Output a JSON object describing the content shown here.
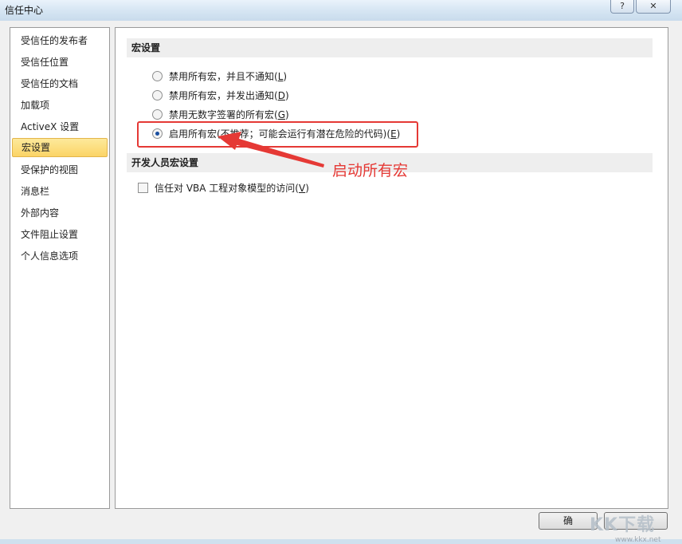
{
  "window": {
    "title": "信任中心",
    "help_label": "?",
    "close_label": "✕"
  },
  "sidebar": {
    "items": [
      {
        "label": "受信任的发布者"
      },
      {
        "label": "受信任位置"
      },
      {
        "label": "受信任的文档"
      },
      {
        "label": "加载项"
      },
      {
        "label": "ActiveX 设置"
      },
      {
        "label": "宏设置",
        "active": true
      },
      {
        "label": "受保护的视图"
      },
      {
        "label": "消息栏"
      },
      {
        "label": "外部内容"
      },
      {
        "label": "文件阻止设置"
      },
      {
        "label": "个人信息选项"
      }
    ]
  },
  "macro_settings": {
    "header": "宏设置",
    "options": [
      {
        "text": "禁用所有宏，并且不通知(",
        "key": "L",
        "tail": ")",
        "checked": false
      },
      {
        "text": "禁用所有宏，并发出通知(",
        "key": "D",
        "tail": ")",
        "checked": false
      },
      {
        "text": "禁用无数字签署的所有宏(",
        "key": "G",
        "tail": ")",
        "checked": false
      },
      {
        "text": "启用所有宏(不推荐；可能会运行有潜在危险的代码)(",
        "key": "E",
        "tail": ")",
        "checked": true
      }
    ]
  },
  "developer_settings": {
    "header": "开发人员宏设置",
    "vba_checkbox": {
      "text": "信任对 VBA 工程对象模型的访问(",
      "key": "V",
      "tail": ")",
      "checked": false
    }
  },
  "annotation": {
    "text": "启动所有宏",
    "color": "#e53935"
  },
  "footer": {
    "ok_label": "确"
  },
  "watermark": {
    "text": "KK下载",
    "sub": "www.kkx.net"
  }
}
